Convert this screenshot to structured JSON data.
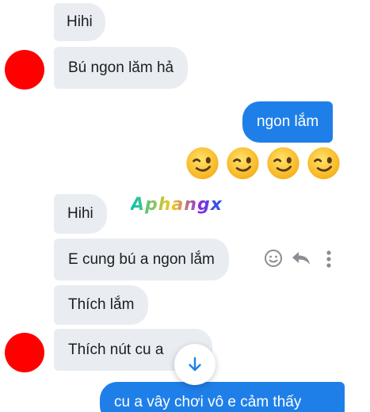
{
  "watermark": "Aphangx",
  "messages": {
    "m1": "Hihi",
    "m2": "Bú ngon lăm hả",
    "m3": "ngon lắm",
    "m4": "Hihi",
    "m5": "E cung bú a ngon lắm",
    "m6": "Thích lắm",
    "m7": "Thích nút cu a",
    "m8": "cu a vây chơi vô e cảm thấy"
  },
  "emoji_reaction": {
    "icon": "winking-face-emoji",
    "count": 4
  },
  "actions": [
    "smiley-react-icon",
    "reply-arrow-icon",
    "more-options-icon"
  ],
  "colors": {
    "incoming_bubble": "#e9edf1",
    "outgoing_bubble": "#1f7fe8",
    "avatar": "#ff0000"
  }
}
